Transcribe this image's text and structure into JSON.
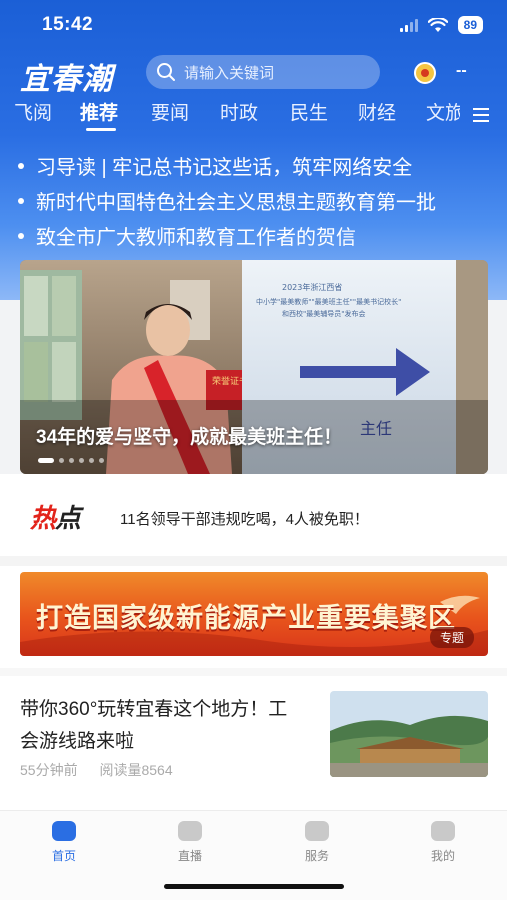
{
  "status": {
    "time": "15:42",
    "battery": "89"
  },
  "app": {
    "logo": "宜春潮"
  },
  "search": {
    "placeholder": "请输入关键词"
  },
  "header": {
    "more": "--"
  },
  "tabs": [
    "飞阅",
    "推荐",
    "要闻",
    "时政",
    "民生",
    "财经",
    "文旅"
  ],
  "ticker": [
    "习导读 | 牢记总书记这些话，筑牢网络安全",
    "新时代中国特色社会主义思想主题教育第一批",
    "致全市广大教师和教育工作者的贺信"
  ],
  "banner": {
    "caption": "34年的爱与坚守，成就最美班主任！",
    "sign_year": "2023年浙江西省",
    "sign_line1": "中小学\"最美教师\"\"最美班主任\"\"最美书记校长\"",
    "sign_line2": "和西校\"最美辅导员\"发布会",
    "sign_bottom": "主任"
  },
  "hot": {
    "badge_main": "热",
    "badge_sub": "点",
    "text": "11名领导干部违规吃喝，4人被免职！"
  },
  "promo": {
    "title": "打造国家级新能源产业重要集聚区",
    "tag": "专题"
  },
  "article": {
    "title": "带你360°玩转宜春这个地方！工会游线路来啦",
    "time": "55分钟前",
    "reads": "阅读量8564"
  },
  "bottom_nav": [
    {
      "label": "首页",
      "icon": "home-icon"
    },
    {
      "label": "直播",
      "icon": "live-icon"
    },
    {
      "label": "服务",
      "icon": "service-icon"
    },
    {
      "label": "我的",
      "icon": "profile-icon"
    }
  ],
  "colors": {
    "brand_blue": "#2a6ee3",
    "promo_red": "#d8351a",
    "hot_red": "#e2231a"
  }
}
